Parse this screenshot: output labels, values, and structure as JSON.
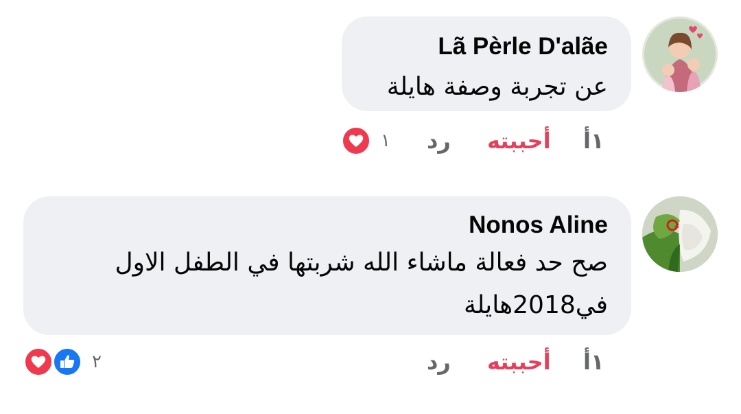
{
  "comments": [
    {
      "author": "Lã Pèrle D'alãe",
      "text_lines": [
        "عن تجربة وصفة هايلة"
      ],
      "time": "١أ",
      "like_label": "أحببته",
      "reply_label": "رد",
      "reaction_count": "١",
      "reactions": [
        "love-icon"
      ]
    },
    {
      "author": "Nonos Aline",
      "text_lines": [
        "صح حد فعالة ماشاء الله شربتها في الطفل الاول",
        "في2018هايلة"
      ],
      "time": "١أ",
      "like_label": "أحببته",
      "reply_label": "رد",
      "reaction_count": "٢",
      "reactions": [
        "love-icon",
        "like-icon"
      ]
    }
  ],
  "colors": {
    "bubble": "#eff0f3",
    "like_active": "#e4405b",
    "meta": "#65676b",
    "love": "#f0384e",
    "like": "#1877f2"
  }
}
